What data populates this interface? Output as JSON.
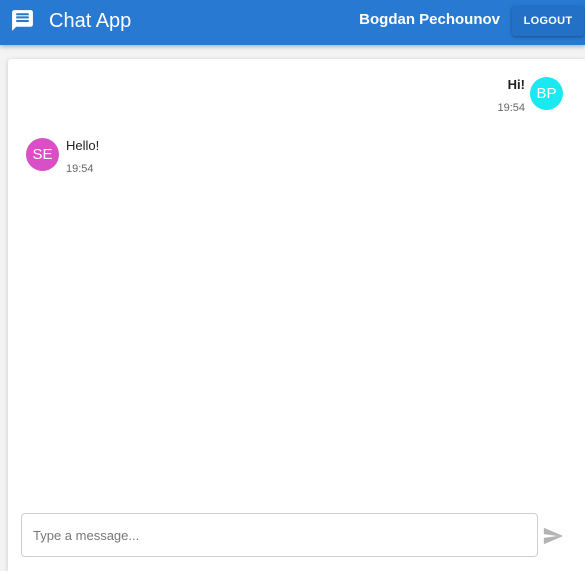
{
  "header": {
    "title": "Chat App",
    "user_name": "Bogdan Pechounov",
    "logout_label": "LOGOUT",
    "app_icon": "chat-bubble-icon",
    "color": "#2779d1"
  },
  "messages": [
    {
      "sender_initials": "BP",
      "text": "Hi!",
      "time": "19:54",
      "side": "right",
      "avatar_color": "#1ce8f2"
    },
    {
      "sender_initials": "SE",
      "text": "Hello!",
      "time": "19:54",
      "side": "left",
      "avatar_color": "#d94fc6"
    }
  ],
  "composer": {
    "value": "",
    "placeholder": "Type a message...",
    "send_icon": "send-icon"
  }
}
